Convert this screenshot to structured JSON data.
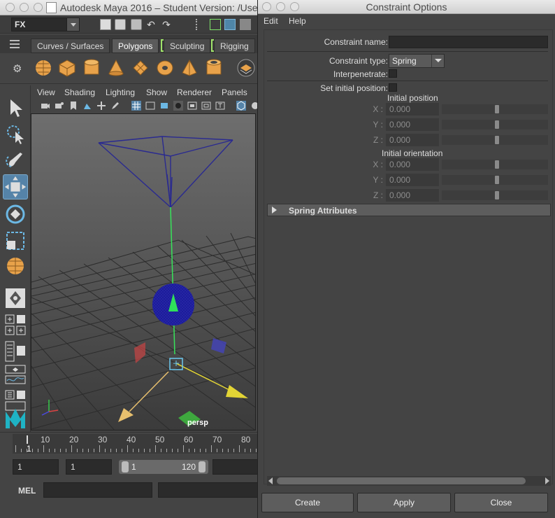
{
  "maya": {
    "window_title": "Autodesk Maya 2016 – Student Version: /Use",
    "menu_set": "FX",
    "shelf_tabs": [
      "Curves / Surfaces",
      "Polygons",
      "Sculpting",
      "Rigging"
    ],
    "active_shelf_tab": "Polygons",
    "shelf_items": [
      "poly-sphere-icon",
      "poly-cube-icon",
      "poly-cylinder-icon",
      "poly-cone-icon",
      "poly-plane-icon",
      "poly-torus-icon",
      "poly-pyramid-icon",
      "poly-pipe-icon",
      "combine-icon"
    ],
    "panel_menu": [
      "View",
      "Shading",
      "Lighting",
      "Show",
      "Renderer",
      "Panels"
    ],
    "viewport_label": "persp",
    "timeline": {
      "ticks": [
        "10",
        "20",
        "30",
        "40",
        "50",
        "60",
        "70",
        "80"
      ],
      "current_frame": "1"
    },
    "range": {
      "start_time": "1",
      "playback_start": "1",
      "range_start": "1",
      "range_end": "120"
    },
    "command_label": "MEL"
  },
  "dialog": {
    "title": "Constraint Options",
    "menu": [
      "Edit",
      "Help"
    ],
    "constraint_name_label": "Constraint name:",
    "constraint_name_value": "",
    "constraint_type_label": "Constraint type:",
    "constraint_type_value": "Spring",
    "interpenetrate_label": "Interpenetrate:",
    "interpenetrate_checked": false,
    "set_initial_position_label": "Set initial position:",
    "set_initial_position_checked": false,
    "initial_position": {
      "heading": "Initial position",
      "rows": [
        {
          "axis": "X :",
          "value": "0.000"
        },
        {
          "axis": "Y :",
          "value": "0.000"
        },
        {
          "axis": "Z :",
          "value": "0.000"
        }
      ]
    },
    "initial_orientation": {
      "heading": "Initial orientation",
      "rows": [
        {
          "axis": "X :",
          "value": "0.000"
        },
        {
          "axis": "Y :",
          "value": "0.000"
        },
        {
          "axis": "Z :",
          "value": "0.000"
        }
      ]
    },
    "spring_attributes_label": "Spring Attributes",
    "buttons": {
      "create": "Create",
      "apply": "Apply",
      "close": "Close"
    }
  },
  "colors": {
    "accent_blue": "#5583a8",
    "shelf_orange": "#e8a24a",
    "green_highlight": "#9fe36a"
  }
}
